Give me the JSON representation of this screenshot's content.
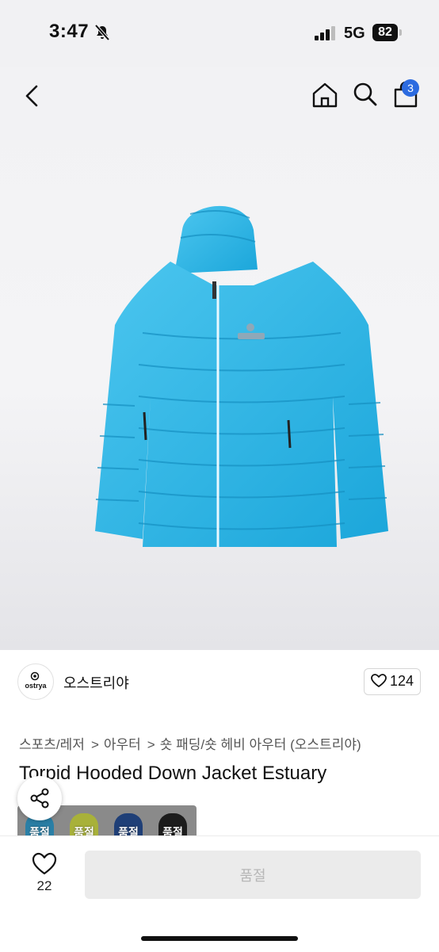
{
  "status_bar": {
    "time": "3:47",
    "network": "5G",
    "battery": "82"
  },
  "nav": {
    "cart_count": "3"
  },
  "brand": {
    "logo_text": "ostrya",
    "name": "오스트리야",
    "like_count": "124"
  },
  "breadcrumb": [
    "스포츠/레저",
    "아우터",
    "숏 패딩/숏 헤비 아우터 (오스트리야)"
  ],
  "product": {
    "title": "Torpid Hooded Down Jacket Estuary",
    "jacket_color": "#2fb6e6"
  },
  "swatches": [
    {
      "label": "품절",
      "color": "#2a7fa6"
    },
    {
      "label": "품절",
      "color": "#a8b13a"
    },
    {
      "label": "품절",
      "color": "#1f3f77"
    },
    {
      "label": "품절",
      "color": "#1c1c1c"
    }
  ],
  "bottom_bar": {
    "wish_count": "22",
    "buy_label": "품절"
  },
  "icons": [
    "bell-off-icon",
    "signal-icon",
    "back-icon",
    "home-icon",
    "search-icon",
    "shopping-bag-icon",
    "heart-icon",
    "share-icon"
  ]
}
